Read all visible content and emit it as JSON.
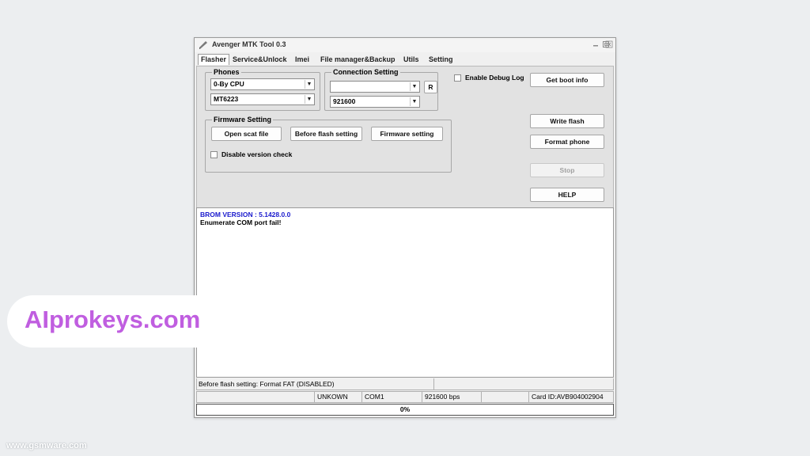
{
  "window": {
    "title": "Avenger MTK Tool 0.3",
    "controls": [
      "minimize-icon",
      "maximize-icon",
      "close-icon"
    ]
  },
  "tabs": [
    {
      "label": "Flasher",
      "active": true
    },
    {
      "label": "Service&Unlock"
    },
    {
      "label": "Imei"
    },
    {
      "label": "File manager&Backup"
    },
    {
      "label": "Utils"
    },
    {
      "label": "Setting"
    }
  ],
  "phones": {
    "legend": "Phones",
    "cpu_value": "0-By CPU",
    "model_value": "MT6223"
  },
  "connection": {
    "legend": "Connection Setting",
    "port_value": "",
    "refresh_label": "R",
    "baud_value": "921600"
  },
  "debug": {
    "label": "Enable Debug Log",
    "checked": false
  },
  "firmware": {
    "legend": "Firmware Setting",
    "open_scat": "Open scat file",
    "before_flash": "Before flash setting",
    "firmware_setting": "Firmware setting",
    "disable_version_check": "Disable version check"
  },
  "actions": {
    "get_boot_info": "Get boot info",
    "write_flash": "Write flash",
    "format_phone": "Format phone",
    "stop": "Stop",
    "help": "HELP"
  },
  "log": {
    "lines": [
      {
        "text": "BROM VERSION : 5.1428.0.0",
        "color": "#1a1acd"
      },
      {
        "text": "Enumerate COM port fail!",
        "color": "#000000"
      }
    ]
  },
  "status": {
    "message": "Before flash setting: Format FAT (DISABLED)",
    "cells": [
      "",
      "UNKOWN",
      "COM1",
      "921600 bps",
      "",
      "Card ID:AVB904002904"
    ]
  },
  "progress": {
    "value": 0,
    "label": "0%"
  },
  "overlay": {
    "promo_text": "AIprokeys.com",
    "watermark": "www.gsmware.com"
  }
}
